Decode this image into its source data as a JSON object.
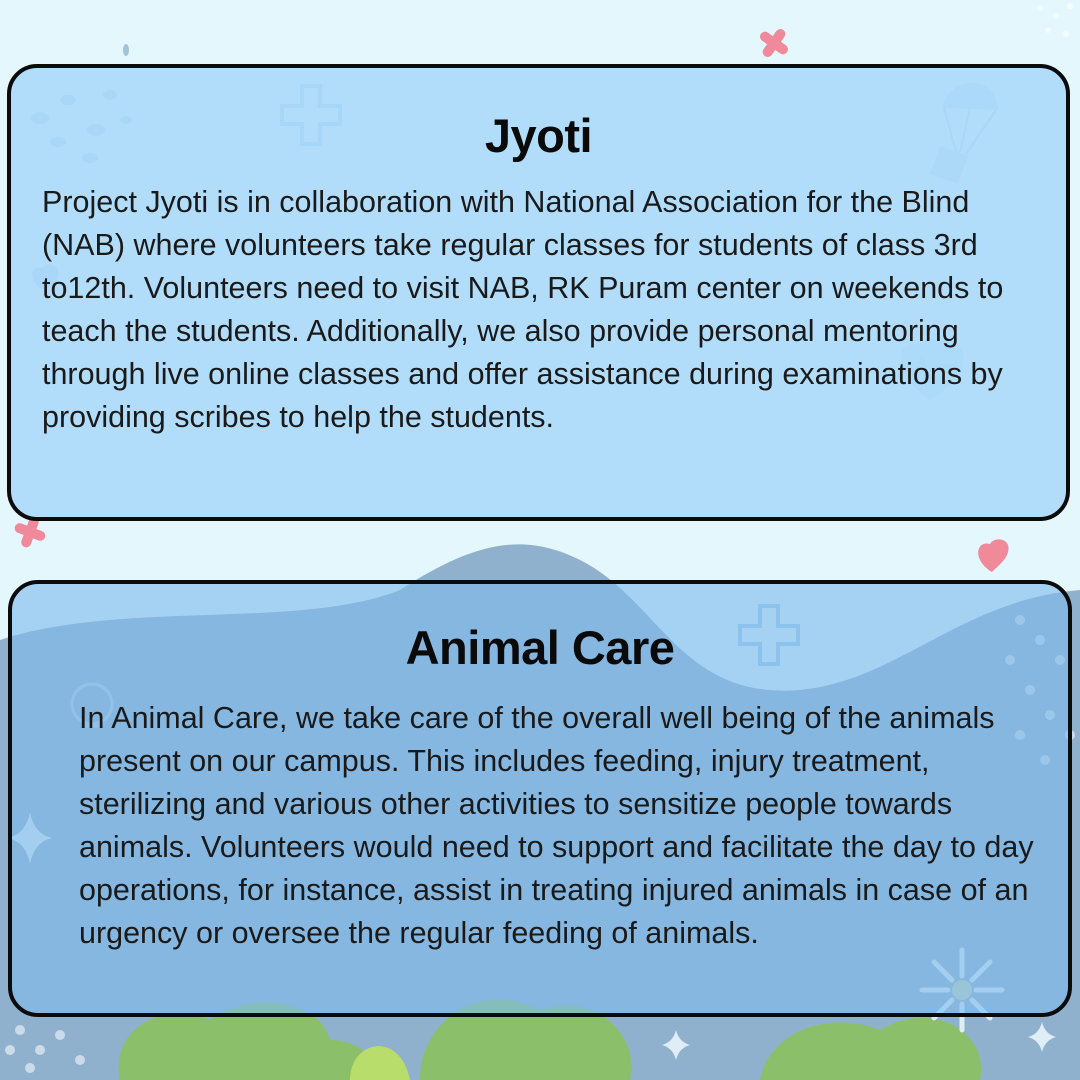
{
  "theme": {
    "background": "#e3f7fc",
    "card_top_fill": "#aadafa",
    "card_bottom_fill": "#80bcec",
    "border": "#0b0b0b",
    "accent_pink": "#f08a9a",
    "hill_blue": "#8fb1cd",
    "plant_green": "#8cbf6a"
  },
  "decorations": [
    "plus-icon",
    "heart-icon",
    "parachute-box-icon",
    "medical-cross-icon",
    "heartbeat-icon",
    "sparkle-icon",
    "lightbulb-icon",
    "flower-icon",
    "plant-icon"
  ],
  "cards": [
    {
      "title": "Jyoti",
      "body": "Project Jyoti is in collaboration with National Association for the Blind (NAB) where volunteers take regular classes for students of class 3rd to12th. Volunteers need to visit NAB, RK Puram center on weekends to teach the students. Additionally, we also provide personal mentoring through live online classes and offer assistance during examinations by providing scribes to help the students."
    },
    {
      "title": "Animal Care",
      "body": "In Animal Care, we take care of the overall well being of the animals present on our campus. This includes feeding, injury treatment, sterilizing and various other activities to sensitize people towards animals. Volunteers would need to support and facilitate the day to day operations, for instance, assist in treating injured animals in case of an urgency or oversee the regular feeding of animals."
    }
  ]
}
